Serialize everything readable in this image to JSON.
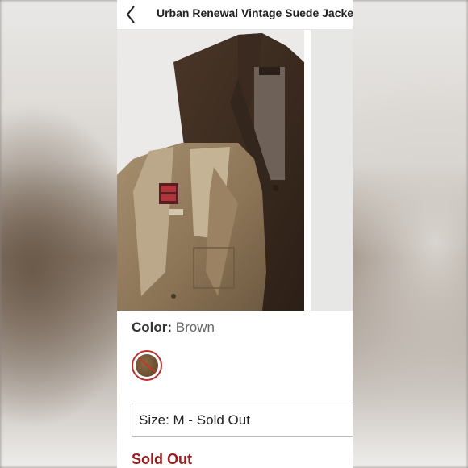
{
  "header": {
    "title": "Urban Renewal Vintage Suede Jacket",
    "back_icon": "chevron-left-icon"
  },
  "product": {
    "image_alt": "",
    "color_label": "Color:",
    "color_value": "Brown",
    "swatch_color": "#6b4a30",
    "swatch_state": "unavailable",
    "size_select_value": "Size: M - Sold Out",
    "availability": "Sold Out"
  },
  "colors": {
    "accent": "#b5332e",
    "sold_out_text": "#9b1c1c"
  }
}
